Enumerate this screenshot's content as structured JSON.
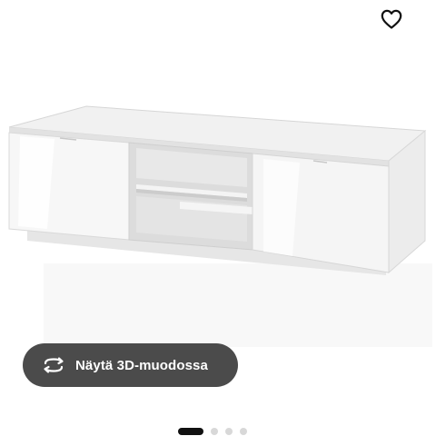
{
  "product": {
    "image_alt": "TV-taso"
  },
  "actions": {
    "favorite_icon": "heart-outline-icon",
    "view_3d_label": "Näytä 3D-muodossa",
    "view_3d_icon": "rotate-icon"
  },
  "carousel": {
    "slide_count": 4,
    "active_index": 0
  },
  "colors": {
    "button_bg": "#4b4b4b",
    "button_text": "#ffffff",
    "dot_active": "#111111",
    "dot_inactive": "#d8d8d8"
  }
}
